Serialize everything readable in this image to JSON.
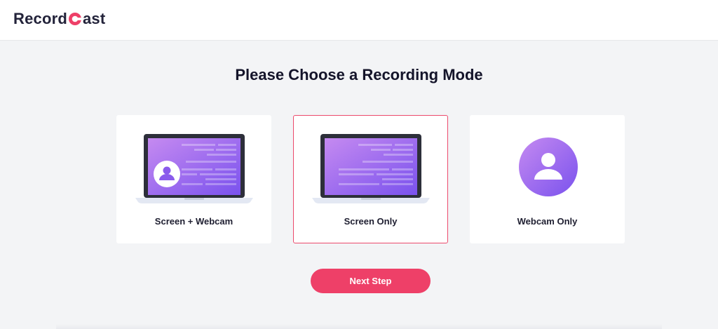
{
  "brand": {
    "name_prefix": "Record",
    "name_suffix": "ast",
    "logo_mark": "record-c-icon",
    "accent_color": "#ee4068"
  },
  "page": {
    "title": "Please Choose a Recording Mode"
  },
  "modes": [
    {
      "label": "Screen + Webcam",
      "icon": "laptop-webcam-icon",
      "selected": false
    },
    {
      "label": "Screen Only",
      "icon": "laptop-screen-icon",
      "selected": true
    },
    {
      "label": "Webcam Only",
      "icon": "webcam-user-icon",
      "selected": false
    }
  ],
  "actions": {
    "next_label": "Next Step"
  },
  "colors": {
    "selected_border": "#ec4a6c",
    "screen_gradient_start": "#c58af0",
    "screen_gradient_end": "#7a52ee"
  }
}
